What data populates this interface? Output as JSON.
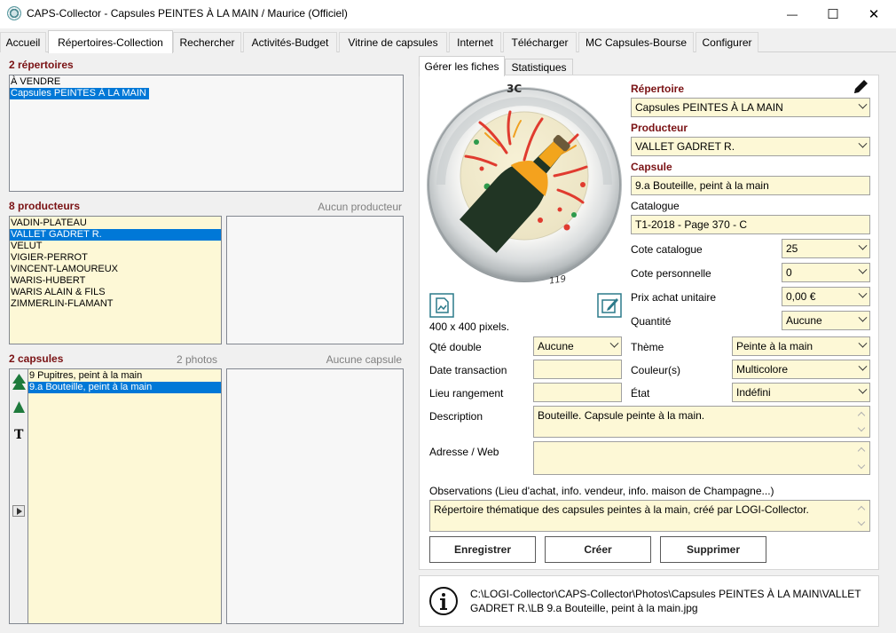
{
  "window": {
    "title": "CAPS-Collector - Capsules PEINTES À LA MAIN / Maurice (Officiel)",
    "minimize": "—",
    "maximize": "☐",
    "close": "✕"
  },
  "tabs": [
    "Accueil",
    "Répertoires-Collection",
    "Rechercher",
    "Activités-Budget",
    "Vitrine de capsules",
    "Internet",
    "Télécharger",
    "MC Capsules-Bourse",
    "Configurer"
  ],
  "active_tab": "Répertoires-Collection",
  "repertoires": {
    "title": "2 répertoires",
    "items": [
      "À VENDRE",
      "Capsules PEINTES À LA MAIN"
    ],
    "selected_index": 1
  },
  "producteurs": {
    "title": "8 producteurs",
    "right_label": "Aucun producteur",
    "items": [
      "VADIN-PLATEAU",
      "VALLET GADRET R.",
      "VELUT",
      "VIGIER-PERROT",
      "VINCENT-LAMOUREUX",
      "WARIS-HUBERT",
      "WARIS ALAIN & FILS",
      "ZIMMERLIN-FLAMANT"
    ],
    "selected_index": 1
  },
  "capsules": {
    "title": "2 capsules",
    "photos_label": "2 photos",
    "right_label": "Aucune capsule",
    "items": [
      "9 Pupitres, peint à la main",
      "9.a Bouteille, peint à la main"
    ],
    "selected_index": 1,
    "tool_t": "T"
  },
  "subtabs": [
    "Gérer les fiches",
    "Statistiques"
  ],
  "form": {
    "repertoire_label": "Répertoire",
    "repertoire_value": "Capsules PEINTES À LA MAIN",
    "producteur_label": "Producteur",
    "producteur_value": "VALLET GADRET R.",
    "capsule_label": "Capsule",
    "capsule_value": "9.a Bouteille, peint à la main",
    "catalogue_label": "Catalogue",
    "catalogue_value": "T1-2018 - Page 370 - C",
    "cote_catalogue_label": "Cote catalogue",
    "cote_catalogue_value": "25",
    "cote_personnelle_label": "Cote personnelle",
    "cote_personnelle_value": "0",
    "prix_label": "Prix achat unitaire",
    "prix_value": "0,00 €",
    "quantite_label": "Quantité",
    "quantite_value": "Aucune",
    "image_size": "400 x 400 pixels.",
    "qte_double_label": "Qté double",
    "qte_double_value": "Aucune",
    "theme_label": "Thème",
    "theme_value": "Peinte à la main",
    "date_label": "Date transaction",
    "date_value": "",
    "couleurs_label": "Couleur(s)",
    "couleurs_value": "Multicolore",
    "lieu_label": "Lieu rangement",
    "lieu_value": "",
    "etat_label": "État",
    "etat_value": "Indéfini",
    "description_label": "Description",
    "description_value": "Bouteille. Capsule peinte à la main.",
    "adresse_label": "Adresse / Web",
    "adresse_value": "",
    "observations_label": "Observations (Lieu d'achat, info. vendeur, info. maison de Champagne...)",
    "observations_value": "Répertoire thématique des capsules peintes à la main, créé par LOGI-Collector."
  },
  "buttons": {
    "save": "Enregistrer",
    "create": "Créer",
    "delete": "Supprimer"
  },
  "path": {
    "line1": "C:\\LOGI-Collector\\CAPS-Collector\\Photos\\Capsules PEINTES À LA MAIN\\VALLET",
    "line2": "GADRET R.\\LB 9.a Bouteille, peint à la main.jpg"
  },
  "capsule_print": {
    "top": "3C",
    "bottom": "119"
  },
  "colors": {
    "accent_red": "#7a1214",
    "field_yellow": "#fdf8d6",
    "selection_blue": "#0078d7",
    "tree_green": "#1e7a3c",
    "image_teal": "#2b7a8a"
  }
}
